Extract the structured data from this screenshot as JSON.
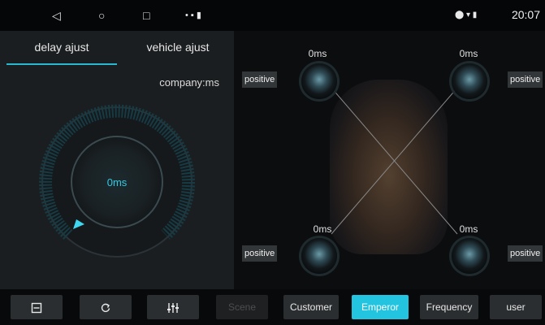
{
  "statusbar": {
    "back_icon": "◁",
    "home_icon": "○",
    "recents_icon": "□",
    "notif_icons": "• ▪ ▮",
    "right_icons": "⬤ ▾ ▮",
    "time": "20:07"
  },
  "tabs": [
    {
      "label": "delay ajust",
      "active": true
    },
    {
      "label": "vehicle ajust",
      "active": false
    }
  ],
  "company_label": "company:ms",
  "dial": {
    "value": "0ms",
    "level": 0
  },
  "speakers": {
    "front_left": {
      "delay": "0ms",
      "phase": "positive"
    },
    "front_right": {
      "delay": "0ms",
      "phase": "positive"
    },
    "rear_left": {
      "delay": "0ms",
      "phase": "positive"
    },
    "rear_right": {
      "delay": "0ms",
      "phase": "positive"
    }
  },
  "toolbar": {
    "save_icon": "save-icon",
    "reset_icon": "reset-icon",
    "eq_icon": "equalizer-icon",
    "buttons": [
      {
        "label": "Scene",
        "state": "disabled"
      },
      {
        "label": "Customer",
        "state": "normal"
      },
      {
        "label": "Emperor",
        "state": "selected"
      },
      {
        "label": "Frequency",
        "state": "normal"
      },
      {
        "label": "user",
        "state": "normal"
      }
    ]
  },
  "colors": {
    "accent": "#22c4e0",
    "panel": "#1b1e20",
    "background": "#0c0d0f"
  }
}
